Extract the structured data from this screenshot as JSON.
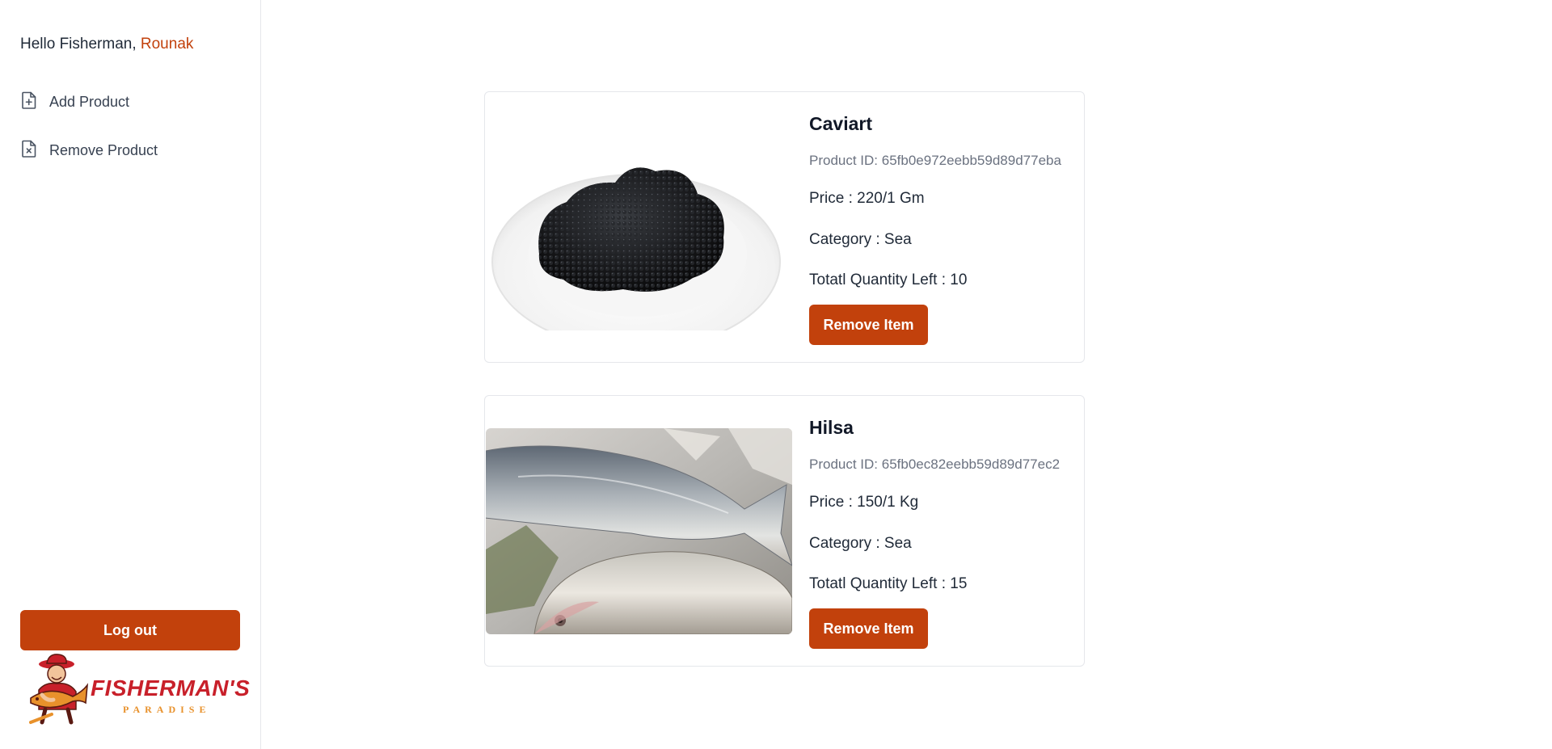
{
  "sidebar": {
    "greeting_prefix": "Hello Fisherman,",
    "user_name": "Rounak",
    "nav": [
      {
        "label": "Add Product",
        "icon": "file-plus-icon"
      },
      {
        "label": "Remove Product",
        "icon": "file-x-icon"
      }
    ],
    "logout_label": "Log out",
    "brand": {
      "name": "FISHERMAN'S",
      "tagline": "PARADISE",
      "icon": "fisherman-mascot-logo"
    }
  },
  "products": [
    {
      "name": "Caviart",
      "product_id_text": "Product ID: 65fb0e972eebb59d89d77eba",
      "price_text": "Price : 220/1 Gm",
      "category_text": "Category : Sea",
      "quantity_text": "Totatl Quantity Left : 10",
      "remove_label": "Remove Item",
      "image": "caviar-bowl-image"
    },
    {
      "name": "Hilsa",
      "product_id_text": "Product ID: 65fb0ec82eebb59d89d77ec2",
      "price_text": "Price : 150/1 Kg",
      "category_text": "Category : Sea",
      "quantity_text": "Totatl Quantity Left : 15",
      "remove_label": "Remove Item",
      "image": "hilsa-fish-image"
    }
  ],
  "colors": {
    "accent": "#c2410c",
    "brand_red": "#c8202a",
    "brand_orange": "#e8912b",
    "border": "#e5e7eb"
  }
}
